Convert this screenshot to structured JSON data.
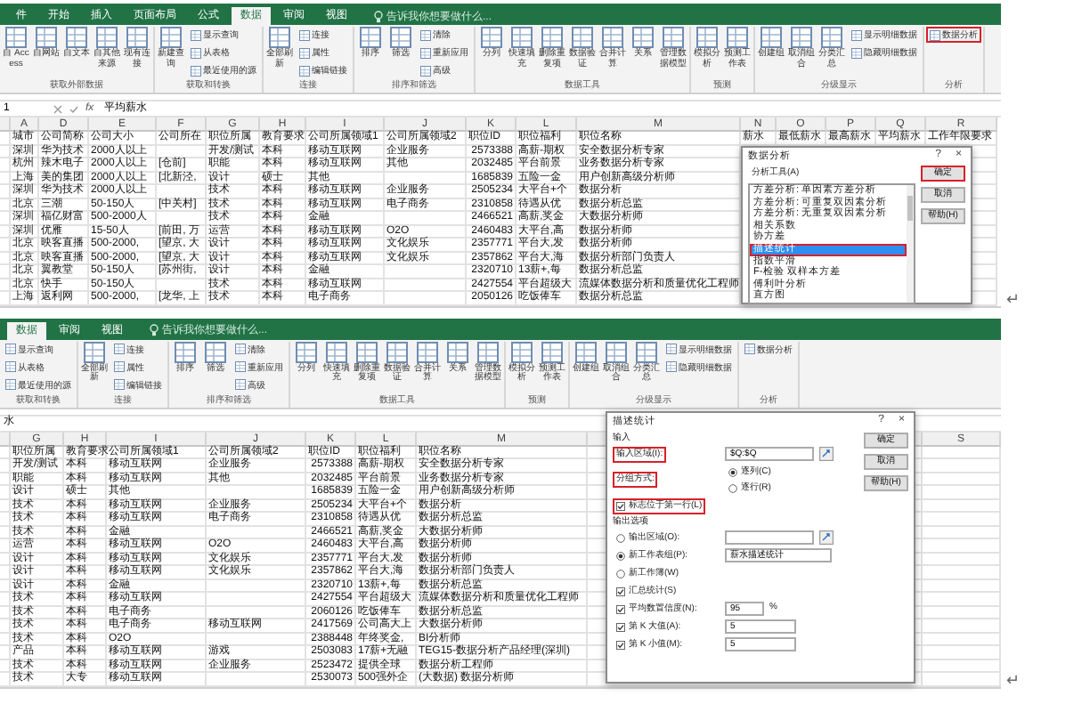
{
  "panes": [
    {
      "tabs": [
        {
          "label": "件",
          "selected": false
        },
        {
          "label": "开始",
          "selected": false
        },
        {
          "label": "插入",
          "selected": false
        },
        {
          "label": "页面布局",
          "selected": false
        },
        {
          "label": "公式",
          "selected": false
        },
        {
          "label": "数据",
          "selected": true
        },
        {
          "label": "审阅",
          "selected": false
        },
        {
          "label": "视图",
          "selected": false
        }
      ],
      "tell_me": "告诉我你想要做什么...",
      "ribbon": [
        {
          "label": "获取外部数据",
          "buttons": [
            {
              "label": "自 Access",
              "kind": "large"
            },
            {
              "label": "自网站",
              "kind": "large"
            },
            {
              "label": "自文本",
              "kind": "large"
            },
            {
              "label": "自其他来源",
              "kind": "large"
            },
            {
              "label": "现有连接",
              "kind": "large"
            }
          ]
        },
        {
          "label": "获取和转换",
          "buttons": [
            {
              "label": "新建查询",
              "kind": "large"
            },
            {
              "label": "显示查询",
              "kind": "small"
            },
            {
              "label": "从表格",
              "kind": "small"
            },
            {
              "label": "最近使用的源",
              "kind": "small"
            }
          ]
        },
        {
          "label": "连接",
          "buttons": [
            {
              "label": "全部刷新",
              "kind": "large"
            },
            {
              "label": "连接",
              "kind": "small"
            },
            {
              "label": "属性",
              "kind": "small"
            },
            {
              "label": "编辑链接",
              "kind": "small"
            }
          ]
        },
        {
          "label": "排序和筛选",
          "buttons": [
            {
              "label": "排序",
              "kind": "large"
            },
            {
              "label": "筛选",
              "kind": "large"
            },
            {
              "label": "清除",
              "kind": "small"
            },
            {
              "label": "重新应用",
              "kind": "small"
            },
            {
              "label": "高级",
              "kind": "small"
            }
          ]
        },
        {
          "label": "数据工具",
          "buttons": [
            {
              "label": "分列",
              "kind": "large"
            },
            {
              "label": "快速填充",
              "kind": "large"
            },
            {
              "label": "删除重复项",
              "kind": "large"
            },
            {
              "label": "数据验证",
              "kind": "large"
            },
            {
              "label": "合并计算",
              "kind": "large"
            },
            {
              "label": "关系",
              "kind": "large"
            },
            {
              "label": "管理数据模型",
              "kind": "large"
            }
          ]
        },
        {
          "label": "预测",
          "buttons": [
            {
              "label": "模拟分析",
              "kind": "large"
            },
            {
              "label": "预测工作表",
              "kind": "large"
            }
          ]
        },
        {
          "label": "分级显示",
          "buttons": [
            {
              "label": "创建组",
              "kind": "large"
            },
            {
              "label": "取消组合",
              "kind": "large"
            },
            {
              "label": "分类汇总",
              "kind": "large"
            },
            {
              "label": "显示明细数据",
              "kind": "small"
            },
            {
              "label": "隐藏明细数据",
              "kind": "small"
            }
          ]
        },
        {
          "label": "分析",
          "buttons": [
            {
              "label": "数据分析",
              "kind": "small",
              "highlighted": true
            }
          ]
        }
      ],
      "name_box": "1",
      "function_label": "fx",
      "formula": "平均薪水",
      "columns": [
        "A",
        "D",
        "E",
        "F",
        "G",
        "H",
        "I",
        "J",
        "K",
        "L",
        "M",
        "N",
        "O",
        "P",
        "Q",
        "R"
      ],
      "rows": [
        [
          "城市",
          "公司简称",
          "公司大小",
          "公司所在",
          "职位所属",
          "教育要求",
          "公司所属领域1",
          "公司所属领域2",
          "职位ID",
          "职位福利",
          "职位名称",
          "薪水",
          "最低薪水",
          "最高薪水",
          "平均薪水",
          "工作年限要求"
        ],
        [
          "深圳",
          "华为技术",
          "2000人以上",
          null,
          "开发/测试",
          "本科",
          "移动互联网",
          "企业服务",
          "2573388",
          "高薪-期权",
          "安全数据分析专家"
        ],
        [
          "杭州",
          "辣木电子",
          "2000人以上",
          "[仓前]",
          "职能",
          "本科",
          "移动互联网",
          "其他",
          "2032485",
          "平台前景",
          "业务数据分析专家"
        ],
        [
          "上海",
          "美的集团",
          "2000人以上",
          "[北新泾,",
          "设计",
          "硕士",
          "其他",
          null,
          "1685839",
          "五险一金",
          "用户创新高级分析师"
        ],
        [
          "深圳",
          "华为技术",
          "2000人以上",
          null,
          "技术",
          "本科",
          "移动互联网",
          "企业服务",
          "2505234",
          "大平台+个",
          "数据分析"
        ],
        [
          "北京",
          "三潮",
          "50-150人",
          "[中关村]",
          "技术",
          "本科",
          "移动互联网",
          "电子商务",
          "2310858",
          "待遇从优",
          "数据分析总监"
        ],
        [
          "深圳",
          "福亿财富",
          "500-2000人",
          null,
          "技术",
          "本科",
          "金融",
          null,
          "2466521",
          "高薪,奖金",
          "大数据分析师"
        ],
        [
          "深圳",
          "优雁",
          "15-50人",
          "[前田, 万",
          "运营",
          "本科",
          "移动互联网",
          "O2O",
          "2460483",
          "大平台,高",
          "数据分析师"
        ],
        [
          "北京",
          "映客直播",
          "500-2000,",
          "[望京, 大",
          "设计",
          "本科",
          "移动互联网",
          "文化娱乐",
          "2357771",
          "平台大,发",
          "数据分析师"
        ],
        [
          "北京",
          "映客直播",
          "500-2000,",
          "[望京, 大",
          "设计",
          "本科",
          "移动互联网",
          "文化娱乐",
          "2357862",
          "平台大,海",
          "数据分析部门负责人"
        ],
        [
          "北京",
          "翼教堂",
          "50-150人",
          "[苏州街,",
          "设计",
          "本科",
          "金融",
          null,
          "2320710",
          "13薪+,每",
          "数据分析总监"
        ],
        [
          "北京",
          "快手",
          "50-150人",
          null,
          "技术",
          "本科",
          "移动互联网",
          null,
          "2427554",
          "平台超级大",
          "流媒体数据分析和质量优化工程师"
        ],
        [
          "上海",
          "返利网",
          "500-2000,",
          "[龙华, 上",
          "技术",
          "本科",
          "电子商务",
          null,
          "2050126",
          "吃饭俸车",
          "数据分析总监"
        ]
      ],
      "dialog": {
        "kind": "tool_list",
        "title": "数据分析",
        "help_glyph": "?",
        "close_glyph": "×",
        "list_label": "分析工具(A)",
        "tools": [
          {
            "label": "方差分析: 单因素方差分析",
            "selected": false
          },
          {
            "label": "方差分析: 可重复双因素分析",
            "selected": false
          },
          {
            "label": "方差分析: 无重复双因素分析",
            "selected": false
          },
          {
            "label": "相关系数",
            "selected": false
          },
          {
            "label": "协方差",
            "selected": false
          },
          {
            "label": "描述统计",
            "selected": true,
            "highlighted": true
          },
          {
            "label": "指数平滑",
            "selected": false
          },
          {
            "label": "F-检验 双样本方差",
            "selected": false
          },
          {
            "label": "傅利叶分析",
            "selected": false
          },
          {
            "label": "直方图",
            "selected": false
          }
        ],
        "buttons": [
          {
            "label": "确定",
            "highlighted": true
          },
          {
            "label": "取消",
            "highlighted": false
          },
          {
            "label": "帮助(H)",
            "highlighted": false
          }
        ]
      },
      "paragraph_mark": "↵"
    },
    {
      "tabs": [
        {
          "label": "数据",
          "selected": true
        },
        {
          "label": "审阅",
          "selected": false
        },
        {
          "label": "视图",
          "selected": false
        }
      ],
      "tell_me": "告诉我你想要做什么...",
      "ribbon": [
        {
          "label": "获取和转换",
          "buttons": [
            {
              "label": "显示查询",
              "kind": "small"
            },
            {
              "label": "从表格",
              "kind": "small"
            },
            {
              "label": "最近使用的源",
              "kind": "small"
            }
          ]
        },
        {
          "label": "连接",
          "buttons": [
            {
              "label": "全部刷新",
              "kind": "large"
            },
            {
              "label": "连接",
              "kind": "small"
            },
            {
              "label": "属性",
              "kind": "small"
            },
            {
              "label": "编辑链接",
              "kind": "small"
            }
          ]
        },
        {
          "label": "排序和筛选",
          "buttons": [
            {
              "label": "排序",
              "kind": "large"
            },
            {
              "label": "筛选",
              "kind": "large"
            },
            {
              "label": "清除",
              "kind": "small"
            },
            {
              "label": "重新应用",
              "kind": "small"
            },
            {
              "label": "高级",
              "kind": "small"
            }
          ]
        },
        {
          "label": "数据工具",
          "buttons": [
            {
              "label": "分列",
              "kind": "large"
            },
            {
              "label": "快速填充",
              "kind": "large"
            },
            {
              "label": "删除重复项",
              "kind": "large"
            },
            {
              "label": "数据验证",
              "kind": "large"
            },
            {
              "label": "合并计算",
              "kind": "large"
            },
            {
              "label": "关系",
              "kind": "large"
            },
            {
              "label": "管理数据模型",
              "kind": "large"
            }
          ]
        },
        {
          "label": "预测",
          "buttons": [
            {
              "label": "模拟分析",
              "kind": "large"
            },
            {
              "label": "预测工作表",
              "kind": "large"
            }
          ]
        },
        {
          "label": "分级显示",
          "buttons": [
            {
              "label": "创建组",
              "kind": "large"
            },
            {
              "label": "取消组合",
              "kind": "large"
            },
            {
              "label": "分类汇总",
              "kind": "large"
            },
            {
              "label": "显示明细数据",
              "kind": "small"
            },
            {
              "label": "隐藏明细数据",
              "kind": "small"
            }
          ]
        },
        {
          "label": "分析",
          "buttons": [
            {
              "label": "数据分析",
              "kind": "small"
            }
          ]
        }
      ],
      "formula": "水",
      "columns": [
        "G",
        "H",
        "I",
        "J",
        "K",
        "L",
        "M",
        "S"
      ],
      "rows": [
        [
          "职位所属",
          "教育要求",
          "公司所属领域1",
          "公司所属领域2",
          "职位ID",
          "职位福利",
          "职位名称"
        ],
        [
          "开发/测试",
          "本科",
          "移动互联网",
          "企业服务",
          "2573388",
          "高薪-期权",
          "安全数据分析专家"
        ],
        [
          "职能",
          "本科",
          "移动互联网",
          "其他",
          "2032485",
          "平台前景",
          "业务数据分析专家"
        ],
        [
          "设计",
          "硕士",
          "其他",
          null,
          "1685839",
          "五险一金",
          "用户创新高级分析师"
        ],
        [
          "技术",
          "本科",
          "移动互联网",
          "企业服务",
          "2505234",
          "大平台+个",
          "数据分析"
        ],
        [
          "技术",
          "本科",
          "移动互联网",
          "电子商务",
          "2310858",
          "待遇从优",
          "数据分析总监"
        ],
        [
          "技术",
          "本科",
          "金融",
          null,
          "2466521",
          "高薪,奖金",
          "大数据分析师"
        ],
        [
          "运营",
          "本科",
          "移动互联网",
          "O2O",
          "2460483",
          "大平台,高",
          "数据分析师"
        ],
        [
          "设计",
          "本科",
          "移动互联网",
          "文化娱乐",
          "2357771",
          "平台大,发",
          "数据分析师"
        ],
        [
          "设计",
          "本科",
          "移动互联网",
          "文化娱乐",
          "2357862",
          "平台大,海",
          "数据分析部门负责人"
        ],
        [
          "设计",
          "本科",
          "金融",
          null,
          "2320710",
          "13薪+,每",
          "数据分析总监"
        ],
        [
          "技术",
          "本科",
          "移动互联网",
          null,
          "2427554",
          "平台超级大",
          "流媒体数据分析和质量优化工程师"
        ],
        [
          "技术",
          "本科",
          "电子商务",
          null,
          "2060126",
          "吃饭俸车",
          "数据分析总监"
        ],
        [
          "技术",
          "本科",
          "电子商务",
          "移动互联网",
          "2417569",
          "公司高大上",
          "大数据分析师"
        ],
        [
          "技术",
          "本科",
          "O2O",
          null,
          "2388448",
          "年终奖金,",
          "BI分析师"
        ],
        [
          "产品",
          "本科",
          "移动互联网",
          "游戏",
          "2503083",
          "17薪+无融",
          "TEG15-数据分析产品经理(深圳)"
        ],
        [
          "技术",
          "本科",
          "移动互联网",
          "企业服务",
          "2523472",
          "提供全球",
          "数据分析工程师"
        ],
        [
          "技术",
          "大专",
          "移动互联网",
          null,
          "2530073",
          "500强外企",
          "(大数据) 数据分析师"
        ]
      ],
      "dialog": {
        "kind": "descriptive",
        "title": "描述统计",
        "help_glyph": "?",
        "close_glyph": "×",
        "input_heading": "输入",
        "input_range": {
          "label": "输入区域(I):",
          "value": "$Q:$Q",
          "highlighted": true
        },
        "grouped_by": {
          "label": "分组方式:",
          "highlighted": true,
          "options": [
            {
              "label": "逐列(C)",
              "selected": true
            },
            {
              "label": "逐行(R)",
              "selected": false
            }
          ]
        },
        "labels_first_row": {
          "label": "标志位于第一行(L)",
          "checked": true,
          "highlighted": true
        },
        "output_heading": "输出选项",
        "output_options": [
          {
            "label": "输出区域(O):",
            "selected": false,
            "kind": "range"
          },
          {
            "label": "新工作表组(P):",
            "selected": true,
            "kind": "text",
            "value": "薪水描述统计"
          },
          {
            "label": "新工作簿(W)",
            "selected": false,
            "kind": "plain"
          }
        ],
        "stats": [
          {
            "label": "汇总统计(S)",
            "checked": true
          },
          {
            "label": "平均数置信度(N):",
            "checked": true,
            "value": "95",
            "unit": "%"
          },
          {
            "label": "第 K 大值(A):",
            "checked": true,
            "value": "5"
          },
          {
            "label": "第 K 小值(M):",
            "checked": true,
            "value": "5"
          }
        ],
        "buttons": [
          {
            "label": "确定",
            "highlighted": false
          },
          {
            "label": "取消",
            "highlighted": false
          },
          {
            "label": "帮助(H)",
            "highlighted": false
          }
        ]
      },
      "paragraph_mark": "↵"
    }
  ]
}
